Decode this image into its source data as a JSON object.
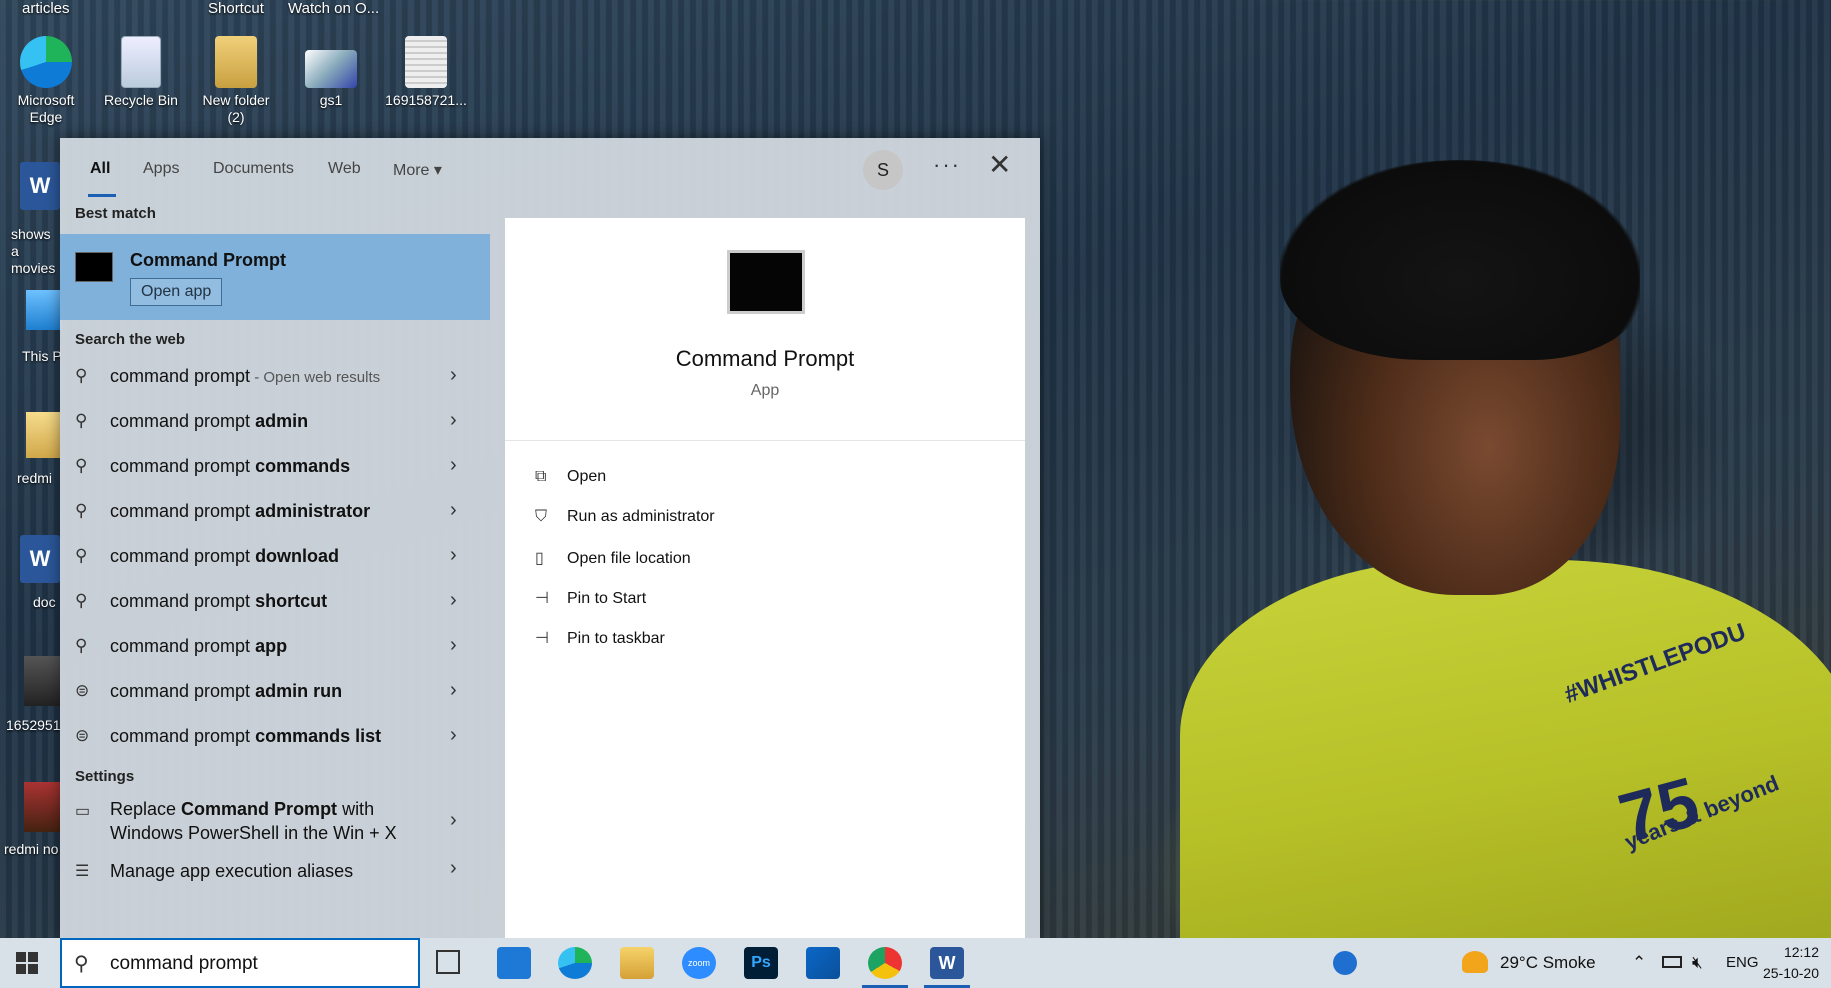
{
  "desktop": {
    "top_labels": [
      "articles",
      "Shortcut",
      "Watch on O..."
    ],
    "icons": [
      {
        "label": "Microsoft Edge"
      },
      {
        "label": "Recycle Bin"
      },
      {
        "label": "New folder (2)"
      },
      {
        "label": "gs1"
      },
      {
        "label": "169158721..."
      }
    ],
    "side_labels": [
      "shows a movies",
      "This P",
      "redmi",
      "doc",
      "1652951",
      "redmi no"
    ]
  },
  "wallpaper": {
    "shirt_text_1": "#WHISTLEPODU",
    "shirt_text_2": "75",
    "shirt_text_3": "years & beyond"
  },
  "search": {
    "tabs": [
      {
        "label": "All",
        "active": true
      },
      {
        "label": "Apps"
      },
      {
        "label": "Documents"
      },
      {
        "label": "Web"
      },
      {
        "label": "More"
      }
    ],
    "more_chevron": "▾",
    "avatar_initial": "S",
    "more_options": "···",
    "close": "✕",
    "best_match_heading": "Best match",
    "best_match": {
      "title": "Command Prompt",
      "button": "Open app"
    },
    "web_heading": "Search the web",
    "web_results": [
      {
        "prefix": "command prompt",
        "bold": "",
        "suffix": " - Open web results",
        "icon": "search-icon"
      },
      {
        "prefix": "command prompt ",
        "bold": "admin",
        "suffix": "",
        "icon": "search-icon"
      },
      {
        "prefix": "command prompt ",
        "bold": "commands",
        "suffix": "",
        "icon": "search-icon"
      },
      {
        "prefix": "command prompt ",
        "bold": "administrator",
        "suffix": "",
        "icon": "search-icon"
      },
      {
        "prefix": "command prompt ",
        "bold": "download",
        "suffix": "",
        "icon": "search-icon"
      },
      {
        "prefix": "command prompt ",
        "bold": "shortcut",
        "suffix": "",
        "icon": "search-icon"
      },
      {
        "prefix": "command prompt ",
        "bold": "app",
        "suffix": "",
        "icon": "search-icon"
      },
      {
        "prefix": "command prompt ",
        "bold": "admin run",
        "suffix": "",
        "icon": "chat-icon"
      },
      {
        "prefix": "command prompt ",
        "bold": "commands list",
        "suffix": "",
        "icon": "chat-icon"
      }
    ],
    "settings_heading": "Settings",
    "settings": [
      {
        "pre": "Replace ",
        "bold": "Command Prompt",
        "post": " with",
        "line2": "Windows PowerShell in the Win + X"
      },
      {
        "pre": "Manage app execution aliases",
        "bold": "",
        "post": "",
        "line2": ""
      }
    ],
    "preview": {
      "title": "Command Prompt",
      "subtitle": "App",
      "actions": [
        "Open",
        "Run as administrator",
        "Open file location",
        "Pin to Start",
        "Pin to taskbar"
      ]
    }
  },
  "taskbar": {
    "search_value": "command prompt",
    "apps": [
      "mail-icon",
      "edge-icon",
      "file-explorer-icon",
      "zoom-icon",
      "photoshop-icon",
      "store-icon",
      "chrome-icon",
      "word-icon"
    ],
    "zoom_text": "zoom",
    "ps_text": "Ps",
    "word_text": "W",
    "weather": "29°C  Smoke",
    "language": "ENG",
    "time": "12:12",
    "date": "25-10-20"
  }
}
